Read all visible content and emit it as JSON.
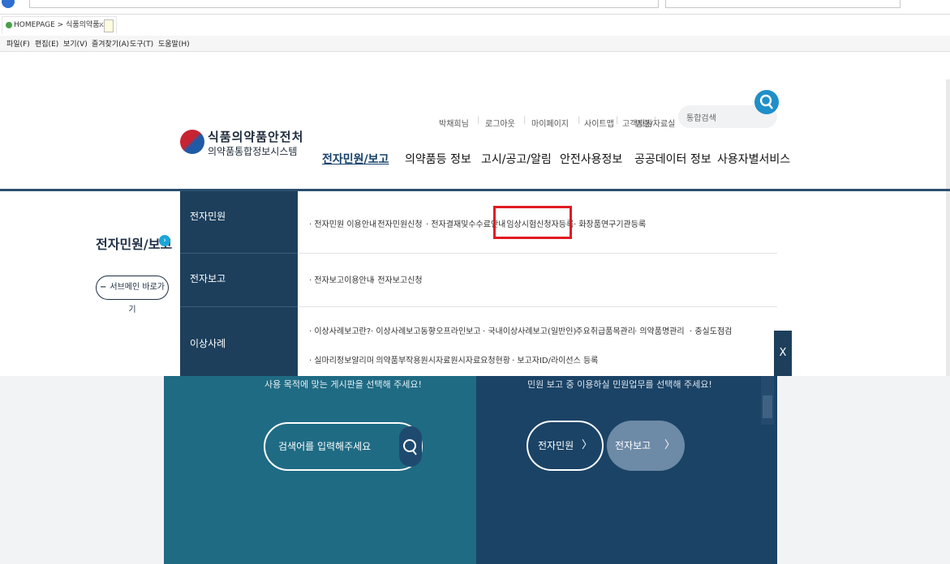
{
  "browser": {
    "tab_title": "HOMEPAGE > 식품의약품...",
    "tab_close": "×",
    "menu": [
      "파일(F)",
      "편집(E)",
      "보기(V)",
      "즐겨찾기(A)",
      "도구(T)",
      "도움말(H)"
    ]
  },
  "header": {
    "logo_line1": "식품의약품안전처",
    "logo_line2": "의약품통합정보시스템",
    "util_links": [
      "박채희님",
      "로그아웃",
      "마이페이지",
      "사이트맵",
      "고객지원",
      "법령/자료실"
    ],
    "search_placeholder": "통합검색",
    "gnb": [
      "전자민원/보고",
      "의약품등 정보",
      "고시/공고/알림",
      "안전사용정보",
      "공공데이터 정보",
      "사용자별서비스"
    ]
  },
  "mega": {
    "side_title": "전자민원/보고",
    "side_dot": "›",
    "side_button": "서브메인 바로가기",
    "side_button_icon": "−",
    "categories": [
      {
        "label": "전자민원",
        "items": [
          "전자민원 이용안내",
          "전자민원신청",
          "전자결재및수수료안내",
          "임상시험신청자등록",
          "화장품연구기관등록"
        ]
      },
      {
        "label": "전자보고",
        "items": [
          "전자보고이용안내",
          "전자보고신청"
        ]
      },
      {
        "label": "이상사례",
        "items": [
          "이상사례보고란?",
          "이상사례보고동향",
          "오프라인보고",
          "국내이상사례보고(일반인)",
          "주요취급품목관리",
          "의약품명관리",
          "충실도점검",
          "실마리정보알리미",
          "의약품부작용원시자료",
          "원시자료요청현황",
          "보고자ID/라이선스 등록"
        ]
      }
    ],
    "close": "X"
  },
  "hero": {
    "cut_text_left": "사용 목적에 맞는 게시판을 선택해 주세요!",
    "cut_text_right": "민원 보고 중 이용하실 민원업무를 선택해 주세요!",
    "search_placeholder": "검색어를 입력해주세요",
    "btn_minwon": "전자민원",
    "btn_report": "전자보고",
    "chevron": "〉"
  },
  "colors": {
    "navy": "#1d3f5c",
    "accent": "#1f8fc9",
    "highlight": "#e11a22",
    "teal": "#1f6b84"
  }
}
